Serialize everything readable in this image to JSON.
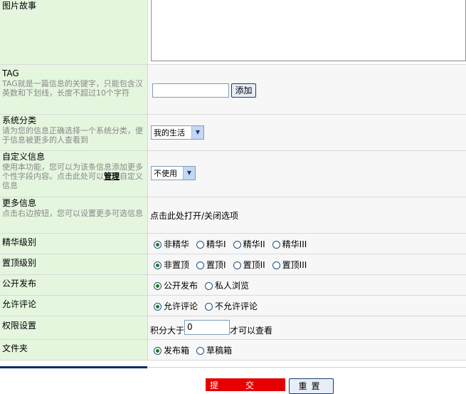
{
  "story": {
    "label": "图片故事"
  },
  "tag": {
    "label": "TAG",
    "desc": "TAG就是一篇信息的关键字，只能包含汉英数和下划线，长度不超过10个字符",
    "input_value": "",
    "add_button": "添加"
  },
  "category": {
    "label": "系统分类",
    "desc": "请为您的信息正确选择一个系统分类，便于信息被更多的人查看到",
    "selected": "我的生活"
  },
  "custom": {
    "label": "自定义信息",
    "desc_before": "使用本功能，您可以为该条信息添加更多个性字段内容。点击此处可以",
    "link": "管理",
    "desc_after": "自定义信息",
    "selected": "不使用"
  },
  "more": {
    "label": "更多信息",
    "desc": "点击右边按钮，您可以设置更多可选信息",
    "toggle_text": "点击此处打开/关闭选项"
  },
  "essence": {
    "label": "精华级别",
    "options": [
      "非精华",
      "精华I",
      "精华II",
      "精华III"
    ],
    "selected_index": 0
  },
  "top": {
    "label": "置顶级别",
    "options": [
      "非置顶",
      "置顶I",
      "置顶II",
      "置顶III"
    ],
    "selected_index": 0
  },
  "publish": {
    "label": "公开发布",
    "options": [
      "公开发布",
      "私人浏览"
    ],
    "selected_index": 0
  },
  "comment": {
    "label": "允许评论",
    "options": [
      "允许评论",
      "不允许评论"
    ],
    "selected_index": 0
  },
  "permission": {
    "label": "权限设置",
    "prefix": "积分大于",
    "value": "0",
    "suffix": "才可以查看"
  },
  "folder": {
    "label": "文件夹",
    "options": [
      "发布箱",
      "草稿箱"
    ],
    "selected_index": 0
  },
  "footer": {
    "submit": "提交",
    "reset": "重置"
  }
}
